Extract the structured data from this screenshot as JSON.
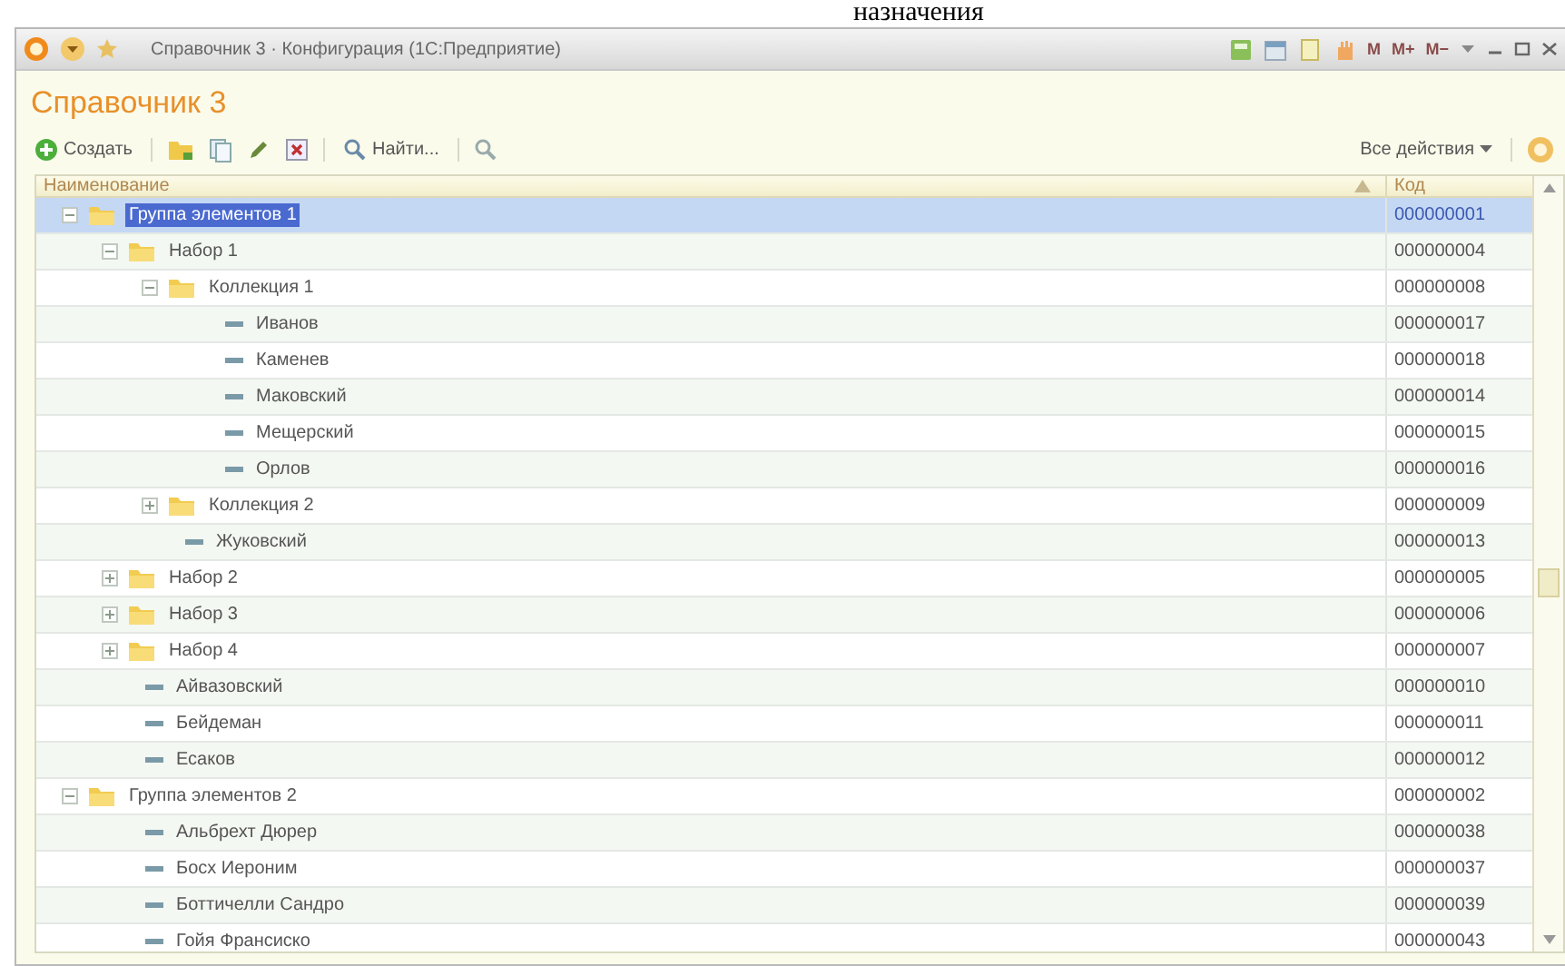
{
  "heading_fragment": "назначения",
  "window": {
    "title": "Справочник 3 · Конфигурация (1С:Предприятие)",
    "memory_buttons": [
      "M",
      "M+",
      "M−"
    ]
  },
  "form_title": "Справочник 3",
  "toolbar": {
    "create": "Создать",
    "find": "Найти...",
    "all_actions": "Все действия"
  },
  "table": {
    "columns": [
      "Наименование",
      "Код"
    ],
    "rows": [
      {
        "kind": "group",
        "name": "Группа элементов 1",
        "code": "000000001",
        "selected": true,
        "expanded": true,
        "children": [
          {
            "kind": "group",
            "name": "Набор 1",
            "code": "000000004",
            "selected": false,
            "expanded": true,
            "children": [
              {
                "kind": "group",
                "name": "Коллекция 1",
                "code": "000000008",
                "selected": false,
                "expanded": true,
                "children": [
                  {
                    "kind": "item",
                    "name": "Иванов",
                    "code": "000000017",
                    "selected": false
                  },
                  {
                    "kind": "item",
                    "name": "Каменев",
                    "code": "000000018",
                    "selected": false
                  },
                  {
                    "kind": "item",
                    "name": "Маковский",
                    "code": "000000014",
                    "selected": false
                  },
                  {
                    "kind": "item",
                    "name": "Мещерский",
                    "code": "000000015",
                    "selected": false
                  },
                  {
                    "kind": "item",
                    "name": "Орлов",
                    "code": "000000016",
                    "selected": false
                  }
                ]
              },
              {
                "kind": "group",
                "name": "Коллекция 2",
                "code": "000000009",
                "selected": false,
                "expanded": false
              },
              {
                "kind": "item",
                "name": "Жуковский",
                "code": "000000013",
                "selected": false
              }
            ]
          },
          {
            "kind": "group",
            "name": "Набор 2",
            "code": "000000005",
            "selected": false,
            "expanded": false
          },
          {
            "kind": "group",
            "name": "Набор 3",
            "code": "000000006",
            "selected": false,
            "expanded": false
          },
          {
            "kind": "group",
            "name": "Набор 4",
            "code": "000000007",
            "selected": false,
            "expanded": false
          },
          {
            "kind": "item",
            "name": "Айвазовский",
            "code": "000000010",
            "selected": false
          },
          {
            "kind": "item",
            "name": "Бейдеман",
            "code": "000000011",
            "selected": false
          },
          {
            "kind": "item",
            "name": "Есаков",
            "code": "000000012",
            "selected": false
          }
        ]
      },
      {
        "kind": "group",
        "name": "Группа элементов 2",
        "code": "000000002",
        "selected": false,
        "expanded": true,
        "children": [
          {
            "kind": "item",
            "name": "Альбрехт Дюрер",
            "code": "000000038",
            "selected": false
          },
          {
            "kind": "item",
            "name": "Босх Иероним",
            "code": "000000037",
            "selected": false
          },
          {
            "kind": "item",
            "name": "Боттичелли Сандро",
            "code": "000000039",
            "selected": false
          },
          {
            "kind": "item",
            "name": "Гойя Франсиско",
            "code": "000000043",
            "selected": false
          }
        ]
      }
    ]
  }
}
